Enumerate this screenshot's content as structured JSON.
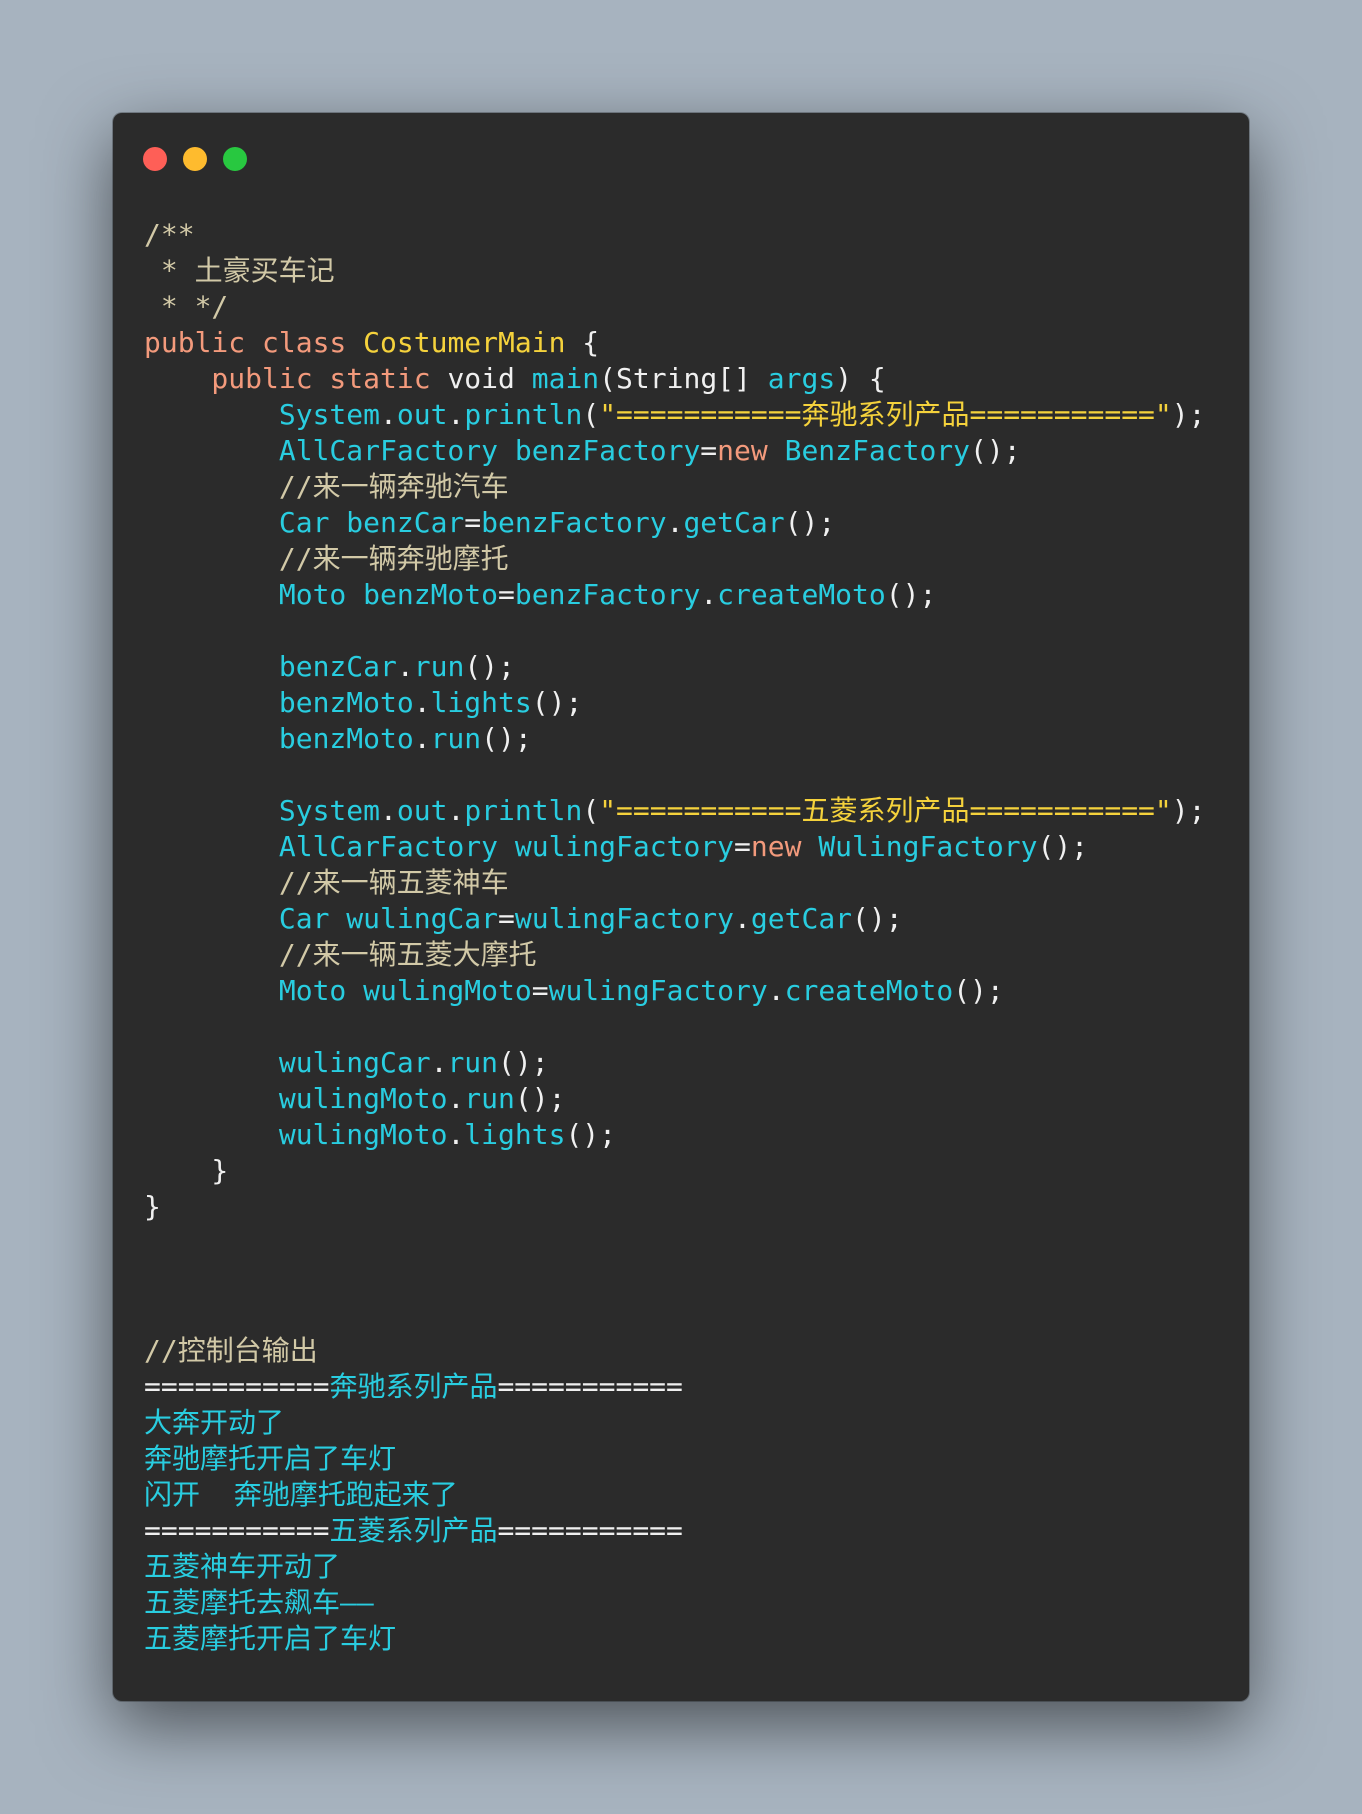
{
  "window": {
    "controls": {
      "close": "close",
      "minimize": "minimize",
      "maximize": "maximize"
    },
    "colors": {
      "background": "#2b2b2b",
      "page_background": "#a7b3bf",
      "close": "#fe5f57",
      "minimize": "#febb2e",
      "maximize": "#28c840"
    }
  },
  "syntax_colors": {
    "comment": "#d2c9a7",
    "keyword": "#f39a7c",
    "class_name": "#f5d23c",
    "plain": "#f0f0f0",
    "identifier": "#29cde0",
    "string": "#f5d23c",
    "output": "#29cde0"
  },
  "code_lines": [
    [
      {
        "t": "/**",
        "k": "comment"
      }
    ],
    [
      {
        "t": " * 土豪买车记",
        "k": "comment"
      }
    ],
    [
      {
        "t": " * */",
        "k": "comment"
      }
    ],
    [
      {
        "t": "public class ",
        "k": "keyword"
      },
      {
        "t": "CostumerMain",
        "k": "class"
      },
      {
        "t": " {",
        "k": "plain"
      }
    ],
    [
      {
        "t": "    public static ",
        "k": "keyword"
      },
      {
        "t": "void ",
        "k": "plain"
      },
      {
        "t": "main",
        "k": "ident"
      },
      {
        "t": "(String[] ",
        "k": "plain"
      },
      {
        "t": "args",
        "k": "ident"
      },
      {
        "t": ") {",
        "k": "plain"
      }
    ],
    [
      {
        "t": "        System",
        "k": "ident"
      },
      {
        "t": ".",
        "k": "plain"
      },
      {
        "t": "out",
        "k": "ident"
      },
      {
        "t": ".",
        "k": "plain"
      },
      {
        "t": "println",
        "k": "ident"
      },
      {
        "t": "(",
        "k": "plain"
      },
      {
        "t": "\"===========奔驰系列产品===========\"",
        "k": "string"
      },
      {
        "t": ");",
        "k": "plain"
      }
    ],
    [
      {
        "t": "        AllCarFactory benzFactory",
        "k": "ident"
      },
      {
        "t": "=",
        "k": "plain"
      },
      {
        "t": "new ",
        "k": "keyword"
      },
      {
        "t": "BenzFactory",
        "k": "ident"
      },
      {
        "t": "();",
        "k": "plain"
      }
    ],
    [
      {
        "t": "        //来一辆奔驰汽车",
        "k": "comment"
      }
    ],
    [
      {
        "t": "        Car benzCar",
        "k": "ident"
      },
      {
        "t": "=",
        "k": "plain"
      },
      {
        "t": "benzFactory",
        "k": "ident"
      },
      {
        "t": ".",
        "k": "plain"
      },
      {
        "t": "getCar",
        "k": "ident"
      },
      {
        "t": "();",
        "k": "plain"
      }
    ],
    [
      {
        "t": "        //来一辆奔驰摩托",
        "k": "comment"
      }
    ],
    [
      {
        "t": "        Moto benzMoto",
        "k": "ident"
      },
      {
        "t": "=",
        "k": "plain"
      },
      {
        "t": "benzFactory",
        "k": "ident"
      },
      {
        "t": ".",
        "k": "plain"
      },
      {
        "t": "createMoto",
        "k": "ident"
      },
      {
        "t": "();",
        "k": "plain"
      }
    ],
    [
      {
        "t": "",
        "k": "plain"
      }
    ],
    [
      {
        "t": "        benzCar",
        "k": "ident"
      },
      {
        "t": ".",
        "k": "plain"
      },
      {
        "t": "run",
        "k": "ident"
      },
      {
        "t": "();",
        "k": "plain"
      }
    ],
    [
      {
        "t": "        benzMoto",
        "k": "ident"
      },
      {
        "t": ".",
        "k": "plain"
      },
      {
        "t": "lights",
        "k": "ident"
      },
      {
        "t": "();",
        "k": "plain"
      }
    ],
    [
      {
        "t": "        benzMoto",
        "k": "ident"
      },
      {
        "t": ".",
        "k": "plain"
      },
      {
        "t": "run",
        "k": "ident"
      },
      {
        "t": "();",
        "k": "plain"
      }
    ],
    [
      {
        "t": "",
        "k": "plain"
      }
    ],
    [
      {
        "t": "        System",
        "k": "ident"
      },
      {
        "t": ".",
        "k": "plain"
      },
      {
        "t": "out",
        "k": "ident"
      },
      {
        "t": ".",
        "k": "plain"
      },
      {
        "t": "println",
        "k": "ident"
      },
      {
        "t": "(",
        "k": "plain"
      },
      {
        "t": "\"===========五菱系列产品===========\"",
        "k": "string"
      },
      {
        "t": ");",
        "k": "plain"
      }
    ],
    [
      {
        "t": "        AllCarFactory wulingFactory",
        "k": "ident"
      },
      {
        "t": "=",
        "k": "plain"
      },
      {
        "t": "new ",
        "k": "keyword"
      },
      {
        "t": "WulingFactory",
        "k": "ident"
      },
      {
        "t": "();",
        "k": "plain"
      }
    ],
    [
      {
        "t": "        //来一辆五菱神车",
        "k": "comment"
      }
    ],
    [
      {
        "t": "        Car wulingCar",
        "k": "ident"
      },
      {
        "t": "=",
        "k": "plain"
      },
      {
        "t": "wulingFactory",
        "k": "ident"
      },
      {
        "t": ".",
        "k": "plain"
      },
      {
        "t": "getCar",
        "k": "ident"
      },
      {
        "t": "();",
        "k": "plain"
      }
    ],
    [
      {
        "t": "        //来一辆五菱大摩托",
        "k": "comment"
      }
    ],
    [
      {
        "t": "        Moto wulingMoto",
        "k": "ident"
      },
      {
        "t": "=",
        "k": "plain"
      },
      {
        "t": "wulingFactory",
        "k": "ident"
      },
      {
        "t": ".",
        "k": "plain"
      },
      {
        "t": "createMoto",
        "k": "ident"
      },
      {
        "t": "();",
        "k": "plain"
      }
    ],
    [
      {
        "t": "",
        "k": "plain"
      }
    ],
    [
      {
        "t": "        wulingCar",
        "k": "ident"
      },
      {
        "t": ".",
        "k": "plain"
      },
      {
        "t": "run",
        "k": "ident"
      },
      {
        "t": "();",
        "k": "plain"
      }
    ],
    [
      {
        "t": "        wulingMoto",
        "k": "ident"
      },
      {
        "t": ".",
        "k": "plain"
      },
      {
        "t": "run",
        "k": "ident"
      },
      {
        "t": "();",
        "k": "plain"
      }
    ],
    [
      {
        "t": "        wulingMoto",
        "k": "ident"
      },
      {
        "t": ".",
        "k": "plain"
      },
      {
        "t": "lights",
        "k": "ident"
      },
      {
        "t": "();",
        "k": "plain"
      }
    ],
    [
      {
        "t": "    }",
        "k": "plain"
      }
    ],
    [
      {
        "t": "}",
        "k": "plain"
      }
    ],
    [
      {
        "t": "",
        "k": "plain"
      }
    ],
    [
      {
        "t": "",
        "k": "plain"
      }
    ],
    [
      {
        "t": "",
        "k": "plain"
      }
    ],
    [
      {
        "t": "//控制台输出",
        "k": "comment"
      }
    ],
    [
      {
        "t": "===========",
        "k": "plain"
      },
      {
        "t": "奔驰系列产品",
        "k": "output"
      },
      {
        "t": "===========",
        "k": "plain"
      }
    ],
    [
      {
        "t": "大奔开动了",
        "k": "output"
      }
    ],
    [
      {
        "t": "奔驰摩托开启了车灯",
        "k": "output"
      }
    ],
    [
      {
        "t": "闪开  奔驰摩托跑起来了",
        "k": "output"
      }
    ],
    [
      {
        "t": "===========",
        "k": "plain"
      },
      {
        "t": "五菱系列产品",
        "k": "output"
      },
      {
        "t": "===========",
        "k": "plain"
      }
    ],
    [
      {
        "t": "五菱神车开动了",
        "k": "output"
      }
    ],
    [
      {
        "t": "五菱摩托去飙车——",
        "k": "output"
      }
    ],
    [
      {
        "t": "五菱摩托开启了车灯",
        "k": "output"
      }
    ]
  ]
}
